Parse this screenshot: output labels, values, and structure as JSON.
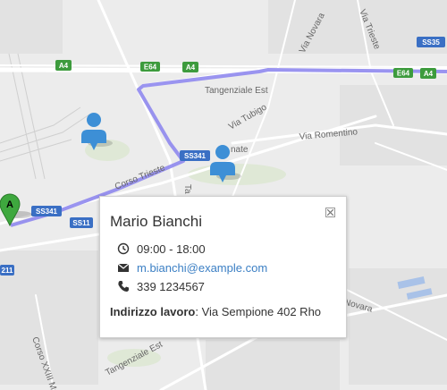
{
  "map": {
    "colors": {
      "background": "#ececec",
      "route": "#8f88ee",
      "road": "#ffffff",
      "marker_green": "#3ea83e",
      "person": "#3d8fd6"
    },
    "shields": [
      "A4",
      "E64",
      "A4",
      "SS35",
      "E64",
      "A4",
      "SS341",
      "SS341",
      "SS11",
      "211"
    ],
    "street_labels": [
      "Via Novara",
      "Via Trieste",
      "Tangenziale Est",
      "Via Tubigo",
      "Via Romentino",
      "Corso Trieste",
      "Via Novara",
      "Tangenziale Est",
      "Corso XXIII Mar",
      "nate",
      "Ta"
    ],
    "marker_a_label": "A",
    "marker_a_icon": "map-pin-icon",
    "person_icon": "person-icon"
  },
  "popup": {
    "name": "Mario Bianchi",
    "hours": "09:00 - 18:00",
    "email": "m.bianchi@example.com",
    "phone": "339 1234567",
    "address_label": "Indirizzo lavoro",
    "address_value": ": Via Sempione 402 Rho",
    "icons": {
      "hours": "clock-icon",
      "email": "envelope-icon",
      "phone": "phone-icon",
      "close": "close-icon"
    }
  }
}
